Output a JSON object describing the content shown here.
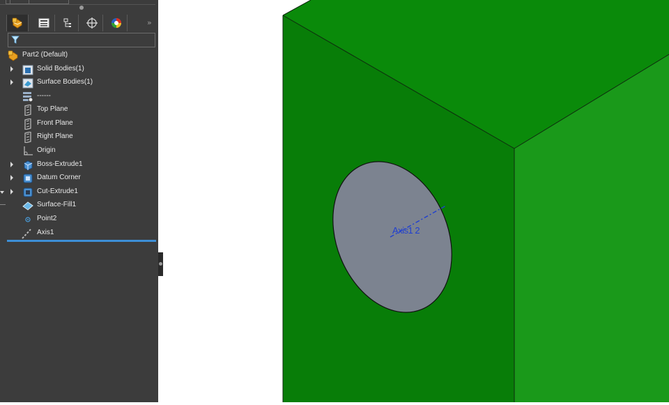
{
  "tree": {
    "items": [
      {
        "label": "Part2  (Default)",
        "icon": "part-icon",
        "arrow": false
      },
      {
        "label": "Solid Bodies(1)",
        "icon": "solid-bodies-folder-icon",
        "arrow": true
      },
      {
        "label": "Surface Bodies(1)",
        "icon": "surface-bodies-folder-icon",
        "arrow": true
      },
      {
        "label": "------",
        "icon": "material-icon",
        "arrow": false
      },
      {
        "label": "Top Plane",
        "icon": "plane-icon",
        "arrow": false
      },
      {
        "label": "Front Plane",
        "icon": "plane-icon",
        "arrow": false
      },
      {
        "label": "Right Plane",
        "icon": "plane-icon",
        "arrow": false
      },
      {
        "label": "Origin",
        "icon": "origin-icon",
        "arrow": false
      },
      {
        "label": "Boss-Extrude1",
        "icon": "boss-extrude-icon",
        "arrow": true
      },
      {
        "label": "Datum Corner",
        "icon": "feature-icon",
        "arrow": true
      },
      {
        "label": "Cut-Extrude1",
        "icon": "cut-extrude-icon",
        "arrow": true
      },
      {
        "label": "Surface-Fill1",
        "icon": "surface-fill-icon",
        "arrow": false
      },
      {
        "label": "Point2",
        "icon": "point-icon",
        "arrow": false
      },
      {
        "label": "Axis1",
        "icon": "axis-icon",
        "arrow": false
      }
    ]
  },
  "tabs": [
    "feature-manager-tab",
    "property-manager-tab",
    "configuration-manager-tab",
    "dimxpert-manager-tab",
    "display-manager-tab"
  ],
  "tabs_more_label": "»",
  "viewport": {
    "axis_label": "Axis1 2",
    "colors": {
      "front_face": "#087d08",
      "right_face": "#1a991a",
      "top_face": "#0a8a0a",
      "hole": "#7c8390",
      "edge": "#0f2a0f",
      "axis": "#1f3fd0"
    }
  }
}
